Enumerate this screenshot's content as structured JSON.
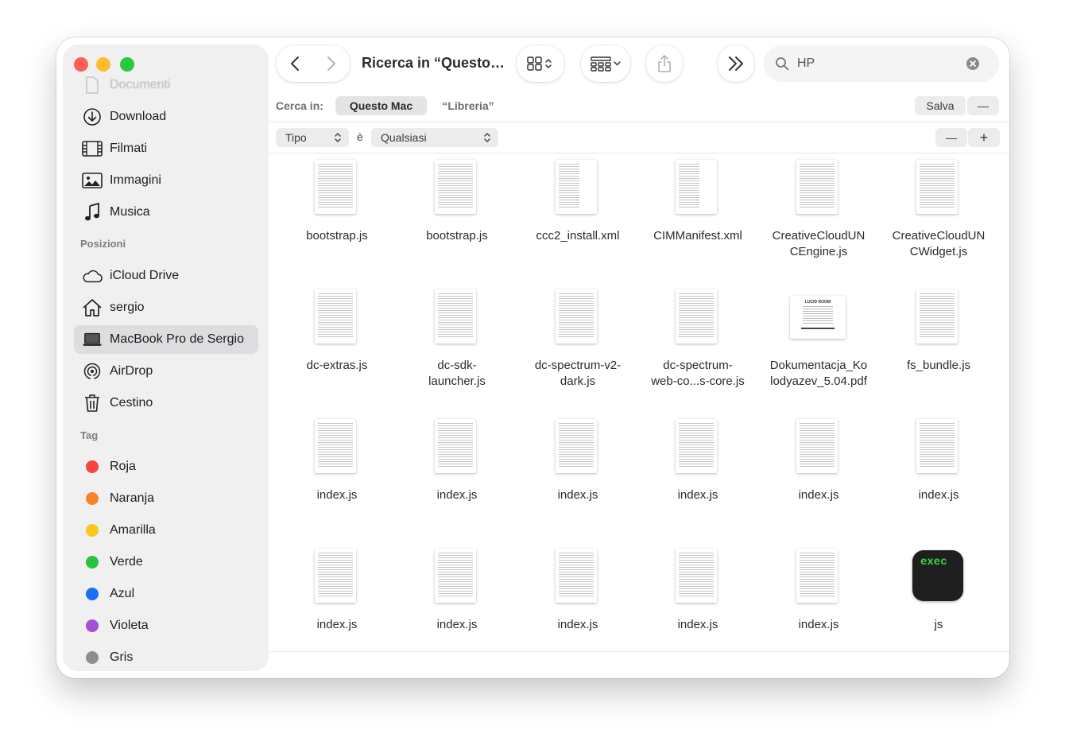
{
  "toolbar": {
    "title": "Ricerca in “Questo…",
    "search_value": "HP"
  },
  "sidebar": {
    "faded_item": "Documenti",
    "favorites": [
      {
        "label": "Download",
        "icon": "download-icon"
      },
      {
        "label": "Filmati",
        "icon": "film-icon"
      },
      {
        "label": "Immagini",
        "icon": "photo-icon"
      },
      {
        "label": "Musica",
        "icon": "music-note-icon"
      }
    ],
    "locations_header": "Posizioni",
    "locations": [
      {
        "label": "iCloud Drive",
        "icon": "cloud-icon"
      },
      {
        "label": "sergio",
        "icon": "home-icon"
      },
      {
        "label": "MacBook Pro de Sergio",
        "icon": "laptop-icon",
        "selected": true
      },
      {
        "label": "AirDrop",
        "icon": "airdrop-icon"
      },
      {
        "label": "Cestino",
        "icon": "trash-icon"
      }
    ],
    "tags_header": "Tag",
    "tags": [
      {
        "label": "Roja",
        "color": "#f5473c"
      },
      {
        "label": "Naranja",
        "color": "#f7822a"
      },
      {
        "label": "Amarilla",
        "color": "#f9c51e"
      },
      {
        "label": "Verde",
        "color": "#29c23e"
      },
      {
        "label": "Azul",
        "color": "#1a6ff2"
      },
      {
        "label": "Violeta",
        "color": "#a64ed6"
      },
      {
        "label": "Gris",
        "color": "#8e8e8e"
      }
    ]
  },
  "scope": {
    "label": "Cerca in:",
    "this_mac": "Questo Mac",
    "library": "“Libreria”",
    "save": "Salva",
    "minus": "—"
  },
  "criteria": {
    "attribute": "Tipo",
    "operator": "è",
    "value": "Qualsiasi",
    "minus": "—",
    "plus": "+"
  },
  "files": [
    [
      "bootstrap.js",
      ""
    ],
    [
      "bootstrap.js",
      ""
    ],
    [
      "ccc2_install.xml",
      ""
    ],
    [
      "CIMManifest.xml",
      ""
    ],
    [
      "CreativeCloudUN",
      "CEngine.js"
    ],
    [
      "CreativeCloudUN",
      "CWidget.js"
    ],
    [
      "dc-extras.js",
      ""
    ],
    [
      "dc-sdk-",
      "launcher.js"
    ],
    [
      "dc-spectrum-v2-",
      "dark.js"
    ],
    [
      "dc-spectrum-",
      "web-co...s-core.js"
    ],
    [
      "Dokumentacja_Ko",
      "lodyazev_5.04.pdf"
    ],
    [
      "fs_bundle.js",
      ""
    ],
    [
      "index.js",
      ""
    ],
    [
      "index.js",
      ""
    ],
    [
      "index.js",
      ""
    ],
    [
      "index.js",
      ""
    ],
    [
      "index.js",
      ""
    ],
    [
      "index.js",
      ""
    ],
    [
      "index.js",
      ""
    ],
    [
      "index.js",
      ""
    ],
    [
      "index.js",
      ""
    ],
    [
      "index.js",
      ""
    ],
    [
      "index.js",
      ""
    ],
    [
      "js",
      ""
    ]
  ],
  "exec_label": "exec",
  "pdf_heading": "LUCID ROOM"
}
